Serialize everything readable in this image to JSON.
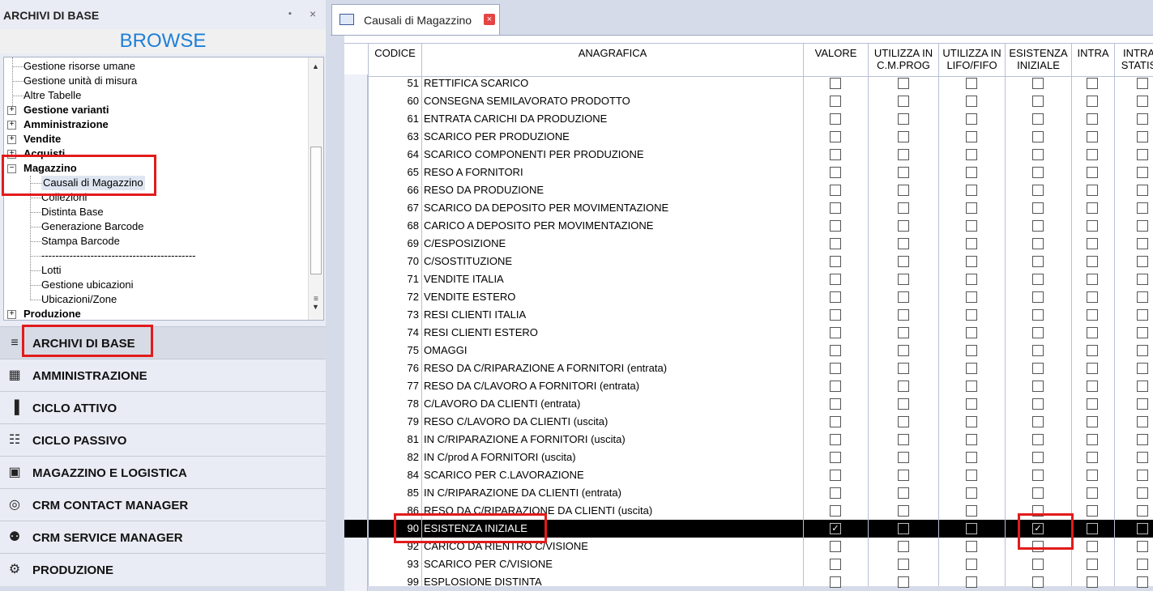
{
  "left_panel": {
    "title": "ARCHIVI DI BASE",
    "pin_glyph": "▪",
    "close_glyph": "×",
    "browse_label": "BROWSE",
    "tree": [
      {
        "label": "Gestione risorse umane",
        "bold": false,
        "level": 1
      },
      {
        "label": "Gestione unità di misura",
        "bold": false,
        "level": 1
      },
      {
        "label": "Altre Tabelle",
        "bold": false,
        "level": 1
      },
      {
        "label": "Gestione varianti",
        "bold": true,
        "level": 0,
        "expander": "+"
      },
      {
        "label": "Amministrazione",
        "bold": true,
        "level": 0,
        "expander": "+"
      },
      {
        "label": "Vendite",
        "bold": true,
        "level": 0,
        "expander": "+"
      },
      {
        "label": "Acquisti",
        "bold": true,
        "level": 0,
        "expander": "+"
      },
      {
        "label": "Magazzino",
        "bold": true,
        "level": 0,
        "expander": "−"
      },
      {
        "label": "Causali di Magazzino",
        "bold": false,
        "level": 2,
        "selected": true
      },
      {
        "label": "Collezioni",
        "bold": false,
        "level": 2
      },
      {
        "label": "Distinta Base",
        "bold": false,
        "level": 2
      },
      {
        "label": "Generazione Barcode",
        "bold": false,
        "level": 2
      },
      {
        "label": "Stampa Barcode",
        "bold": false,
        "level": 2
      },
      {
        "label": "--------------------------------------------",
        "bold": false,
        "level": 2
      },
      {
        "label": "Lotti",
        "bold": false,
        "level": 2
      },
      {
        "label": "Gestione ubicazioni",
        "bold": false,
        "level": 2
      },
      {
        "label": "Ubicazioni/Zone",
        "bold": false,
        "level": 2
      },
      {
        "label": "Produzione",
        "bold": true,
        "level": 0,
        "expander": "+"
      }
    ],
    "nav": [
      {
        "label": "ARCHIVI DI BASE",
        "icon": "server-icon",
        "glyph": "≡",
        "active": true
      },
      {
        "label": "AMMINISTRAZIONE",
        "icon": "calculator-icon",
        "glyph": "▦"
      },
      {
        "label": "CICLO ATTIVO",
        "icon": "bar-chart-icon",
        "glyph": "▐"
      },
      {
        "label": "CICLO PASSIVO",
        "icon": "cart-icon",
        "glyph": "☷"
      },
      {
        "label": "MAGAZZINO E LOGISTICA",
        "icon": "forklift-icon",
        "glyph": "▣"
      },
      {
        "label": "CRM CONTACT MANAGER",
        "icon": "globe-icon",
        "glyph": "◎"
      },
      {
        "label": "CRM SERVICE MANAGER",
        "icon": "people-icon",
        "glyph": "⚉"
      },
      {
        "label": "PRODUZIONE",
        "icon": "gear-icon",
        "glyph": "⚙"
      }
    ]
  },
  "tab": {
    "label": "Causali di Magazzino",
    "close_glyph": "×"
  },
  "grid": {
    "columns": [
      "CODICE",
      "ANAGRAFICA",
      "VALORE",
      "UTILIZZA IN C.M.PROG",
      "UTILIZZA IN LIFO/FIFO",
      "ESISTENZA INIZIALE",
      "INTRA",
      "INTRA STATISTICA"
    ],
    "column_headers": [
      {
        "l1": "CODICE",
        "l2": ""
      },
      {
        "l1": "ANAGRAFICA",
        "l2": ""
      },
      {
        "l1": "VALORE",
        "l2": ""
      },
      {
        "l1": "UTILIZZA IN",
        "l2": "C.M.PROG"
      },
      {
        "l1": "UTILIZZA IN",
        "l2": "LIFO/FIFO"
      },
      {
        "l1": "ESISTENZA",
        "l2": "INIZIALE"
      },
      {
        "l1": "INTRA",
        "l2": ""
      },
      {
        "l1": "INTRA",
        "l2": "STATIS"
      }
    ],
    "check_glyph": "✓",
    "rows": [
      {
        "code": "51",
        "name": "RETTIFICA SCARICO",
        "valore": false,
        "esistenza": false
      },
      {
        "code": "60",
        "name": "CONSEGNA SEMILAVORATO PRODOTTO",
        "valore": false,
        "esistenza": false
      },
      {
        "code": "61",
        "name": "ENTRATA CARICHI DA PRODUZIONE",
        "valore": false,
        "esistenza": false
      },
      {
        "code": "63",
        "name": "SCARICO PER PRODUZIONE",
        "valore": false,
        "esistenza": false
      },
      {
        "code": "64",
        "name": "SCARICO COMPONENTI PER PRODUZIONE",
        "valore": false,
        "esistenza": false
      },
      {
        "code": "65",
        "name": "RESO A FORNITORI",
        "valore": false,
        "esistenza": false
      },
      {
        "code": "66",
        "name": "RESO DA PRODUZIONE",
        "valore": false,
        "esistenza": false
      },
      {
        "code": "67",
        "name": "SCARICO DA DEPOSITO PER MOVIMENTAZIONE",
        "valore": false,
        "esistenza": false
      },
      {
        "code": "68",
        "name": "CARICO A DEPOSITO PER MOVIMENTAZIONE",
        "valore": false,
        "esistenza": false
      },
      {
        "code": "69",
        "name": "C/ESPOSIZIONE",
        "valore": false,
        "esistenza": false
      },
      {
        "code": "70",
        "name": "C/SOSTITUZIONE",
        "valore": false,
        "esistenza": false
      },
      {
        "code": "71",
        "name": "VENDITE ITALIA",
        "valore": false,
        "esistenza": false
      },
      {
        "code": "72",
        "name": "VENDITE ESTERO",
        "valore": false,
        "esistenza": false
      },
      {
        "code": "73",
        "name": "RESI CLIENTI ITALIA",
        "valore": false,
        "esistenza": false
      },
      {
        "code": "74",
        "name": "RESI CLIENTI ESTERO",
        "valore": false,
        "esistenza": false
      },
      {
        "code": "75",
        "name": "OMAGGI",
        "valore": false,
        "esistenza": false
      },
      {
        "code": "76",
        "name": "RESO  DA C/RIPARAZIONE A FORNITORI (entrata)",
        "valore": false,
        "esistenza": false
      },
      {
        "code": "77",
        "name": "RESO DA C/LAVORO A FORNITORI (entrata)",
        "valore": false,
        "esistenza": false
      },
      {
        "code": "78",
        "name": "C/LAVORO DA CLIENTI (entrata)",
        "valore": false,
        "esistenza": false
      },
      {
        "code": "79",
        "name": "RESO C/LAVORO DA CLIENTI (uscita)",
        "valore": false,
        "esistenza": false
      },
      {
        "code": "81",
        "name": "IN C/RIPARAZIONE A FORNITORI (uscita)",
        "valore": false,
        "esistenza": false
      },
      {
        "code": "82",
        "name": "IN C/prod A FORNITORI (uscita)",
        "valore": false,
        "esistenza": false
      },
      {
        "code": "84",
        "name": "SCARICO PER C.LAVORAZIONE",
        "valore": false,
        "esistenza": false
      },
      {
        "code": "85",
        "name": "IN C/RIPARAZIONE DA CLIENTI (entrata)",
        "valore": false,
        "esistenza": false
      },
      {
        "code": "86",
        "name": "RESO DA C/RIPARAZIONE DA CLIENTI (uscita)",
        "valore": false,
        "esistenza": false
      },
      {
        "code": "90",
        "name": "ESISTENZA INIZIALE",
        "valore": true,
        "esistenza": true,
        "selected": true
      },
      {
        "code": "92",
        "name": "CARICO DA RIENTRO C/VISIONE",
        "valore": false,
        "esistenza": false
      },
      {
        "code": "93",
        "name": "SCARICO PER  C/VISIONE",
        "valore": false,
        "esistenza": false
      },
      {
        "code": "99",
        "name": "ESPLOSIONE DISTINTA",
        "valore": false,
        "esistenza": false
      }
    ]
  },
  "colors": {
    "accent": "#1e7fd6",
    "highlight_box": "#e21b1b",
    "selected_row": "#000000"
  }
}
